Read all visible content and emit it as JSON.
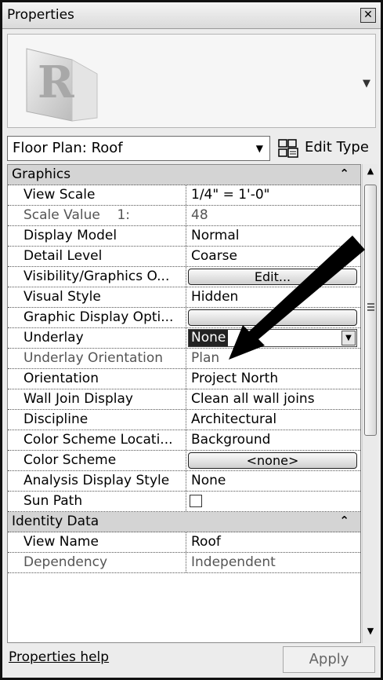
{
  "window": {
    "title": "Properties"
  },
  "type_selector": {
    "value": "Floor Plan: Roof",
    "edit_type_label": "Edit Type"
  },
  "groups": [
    {
      "name": "Graphics",
      "rows": [
        {
          "name": "View Scale",
          "value": "1/4\" = 1'-0\""
        },
        {
          "name": "Scale Value    1:",
          "value": "48"
        },
        {
          "name": "Display Model",
          "value": "Normal"
        },
        {
          "name": "Detail Level",
          "value": "Coarse"
        },
        {
          "name": "Visibility/Graphics O...",
          "value": "Edit..."
        },
        {
          "name": "Visual Style",
          "value": "Hidden"
        },
        {
          "name": "Graphic Display Opti...",
          "value": ""
        },
        {
          "name": "Underlay",
          "value": "None"
        },
        {
          "name": "Underlay Orientation",
          "value": "Plan"
        },
        {
          "name": "Orientation",
          "value": "Project North"
        },
        {
          "name": "Wall Join Display",
          "value": "Clean all wall joins"
        },
        {
          "name": "Discipline",
          "value": "Architectural"
        },
        {
          "name": "Color Scheme Locati...",
          "value": "Background"
        },
        {
          "name": "Color Scheme",
          "value": "<none>"
        },
        {
          "name": "Analysis Display Style",
          "value": "None"
        },
        {
          "name": "Sun Path",
          "value": ""
        }
      ]
    },
    {
      "name": "Identity Data",
      "rows": [
        {
          "name": "View Name",
          "value": "Roof"
        },
        {
          "name": "Dependency",
          "value": "Independent"
        }
      ]
    }
  ],
  "footer": {
    "help_label": "Properties help",
    "apply_label": "Apply"
  },
  "icons": {
    "close": "close-icon",
    "edit_type": "edit-type-icon",
    "dropdown": "chevron-down-icon",
    "collapse": "collapse-chevron-icon",
    "logo": "revit-logo-icon"
  }
}
